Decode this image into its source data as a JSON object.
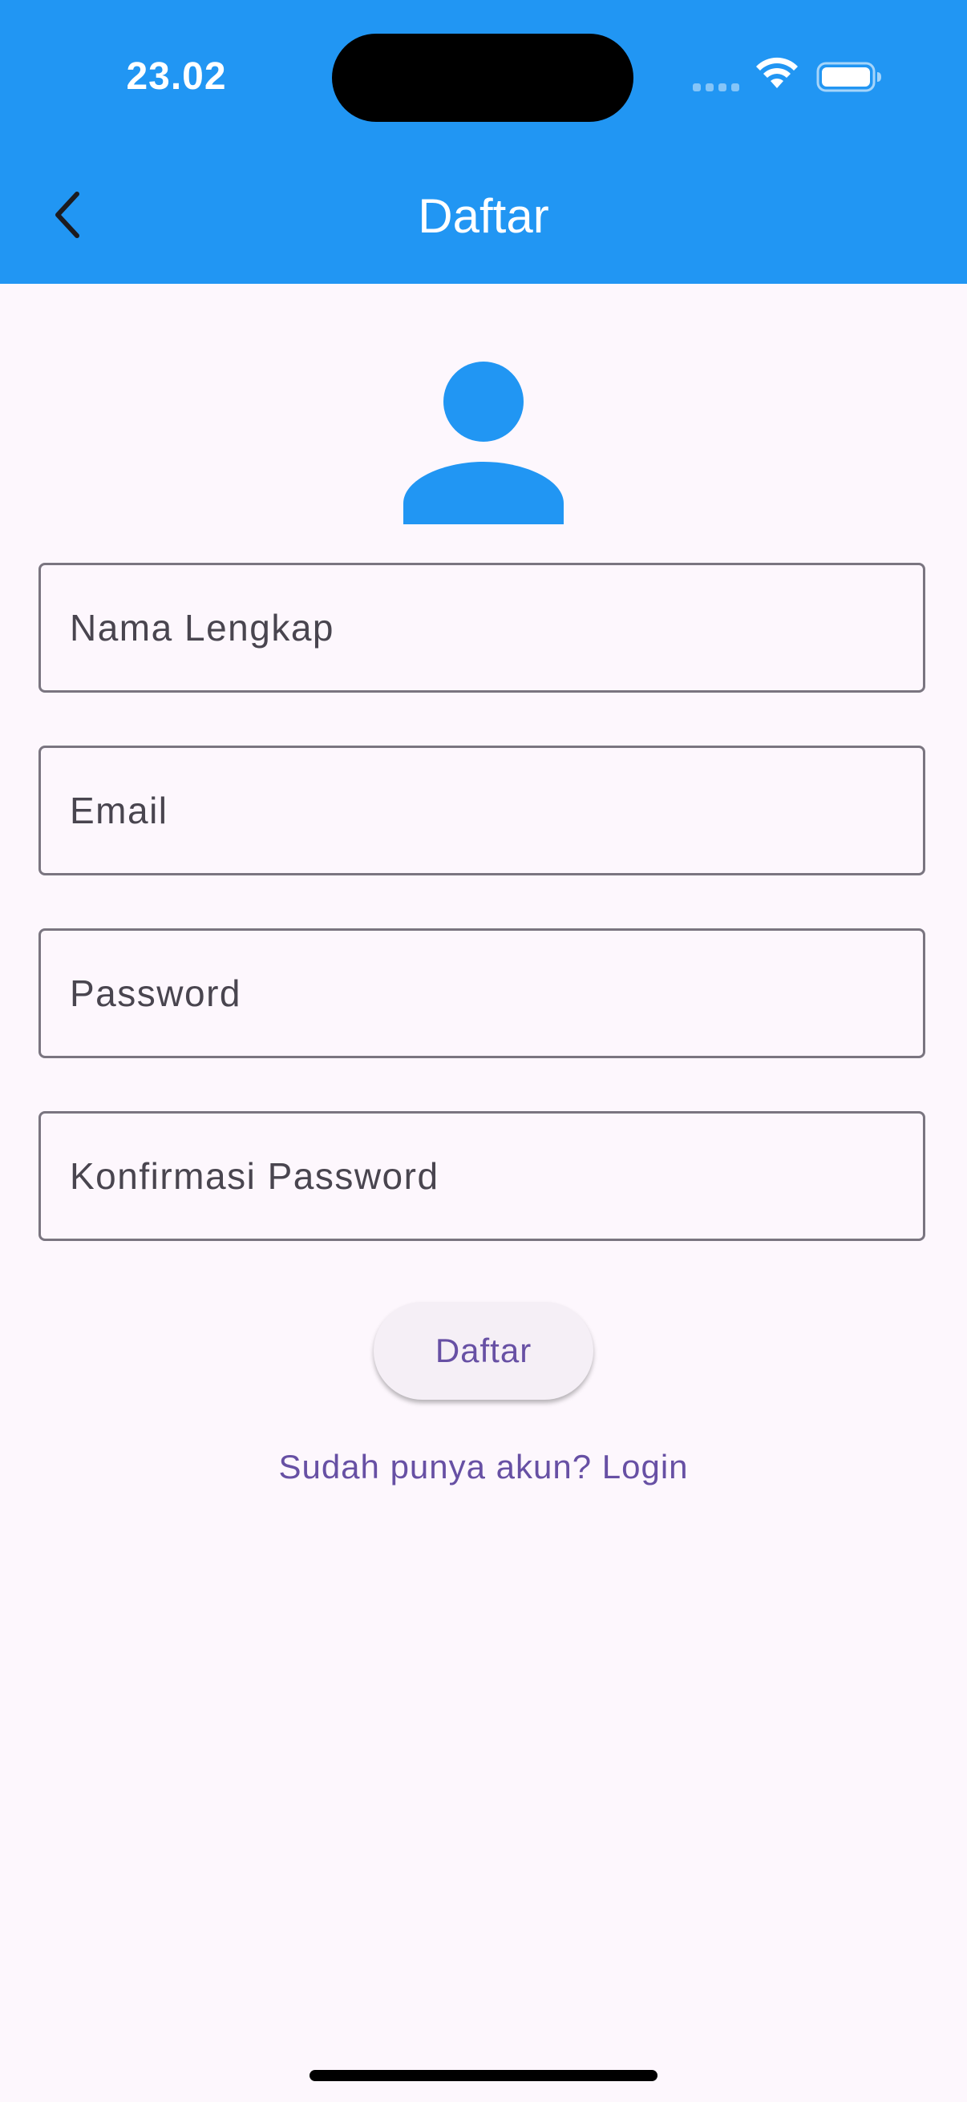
{
  "status_bar": {
    "time": "23.02"
  },
  "app_bar": {
    "title": "Daftar",
    "background_color": "#2196F3",
    "back_icon": "chevron-left-icon"
  },
  "avatar": {
    "icon": "person-icon",
    "color": "#2196F3"
  },
  "form": {
    "fields": [
      {
        "placeholder": "Nama Lengkap",
        "value": ""
      },
      {
        "placeholder": "Email",
        "value": ""
      },
      {
        "placeholder": "Password",
        "value": ""
      },
      {
        "placeholder": "Konfirmasi Password",
        "value": ""
      }
    ],
    "submit_label": "Daftar",
    "login_link": "Sudah punya akun? Login"
  },
  "colors": {
    "accent": "#6750A4",
    "background": "#FDF7FD"
  }
}
